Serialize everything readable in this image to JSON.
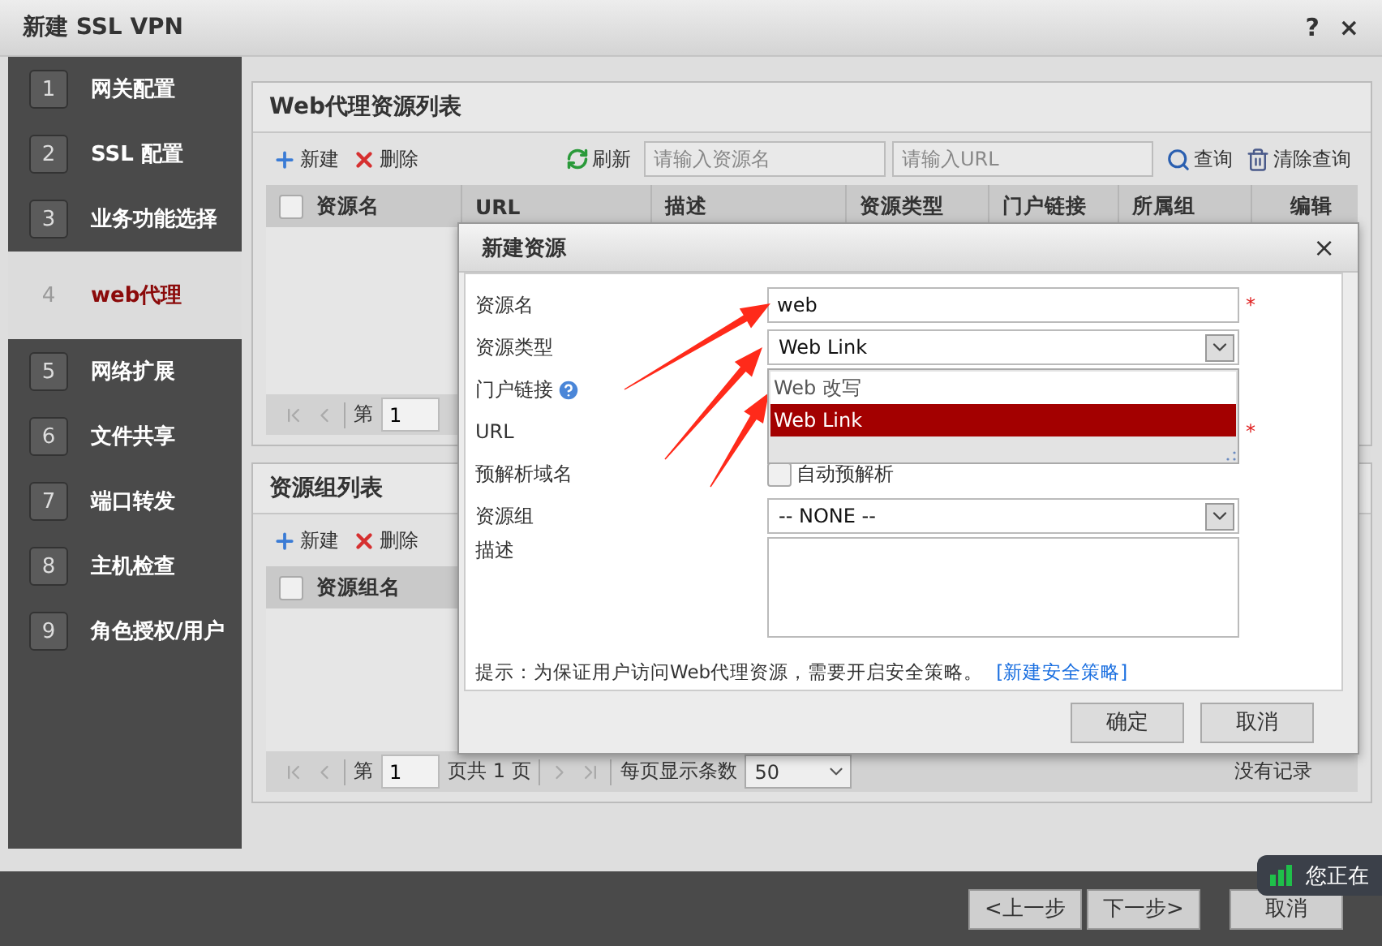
{
  "window": {
    "title": "新建 SSL VPN",
    "help": "?",
    "close": "×"
  },
  "steps": [
    {
      "number": "1",
      "label": "网关配置",
      "selected": false
    },
    {
      "number": "2",
      "label": "SSL 配置",
      "selected": false
    },
    {
      "number": "3",
      "label": "业务功能选择",
      "selected": false
    },
    {
      "number": "4",
      "label": "web代理",
      "selected": true
    },
    {
      "number": "5",
      "label": "网络扩展",
      "selected": false
    },
    {
      "number": "6",
      "label": "文件共享",
      "selected": false
    },
    {
      "number": "7",
      "label": "端口转发",
      "selected": false
    },
    {
      "number": "8",
      "label": "主机检查",
      "selected": false
    },
    {
      "number": "9",
      "label": "角色授权/用户",
      "selected": false
    }
  ],
  "resource_panel": {
    "title": "Web代理资源列表",
    "toolbar": {
      "new": "新建",
      "delete": "删除",
      "refresh": "刷新",
      "name_search": {
        "placeholder": "请输入资源名"
      },
      "url_search": {
        "placeholder": "请输入URL"
      },
      "query": "查询",
      "clear_query": "清除查询"
    },
    "select_all": {
      "checked": false
    },
    "columns": [
      "资源名",
      "URL",
      "描述",
      "资源类型",
      "门户链接",
      "所属组",
      "编辑"
    ],
    "pager": {
      "page_label": "第",
      "page": "1"
    }
  },
  "group_panel": {
    "title": "资源组列表",
    "toolbar": {
      "new": "新建",
      "delete": "删除"
    },
    "select_all": {
      "checked": false
    },
    "columns": [
      "资源组名"
    ],
    "pager": {
      "page_label": "第",
      "page": "1",
      "page_total": "页共 1 页",
      "per_page_label": "每页显示条数",
      "per_page": "50",
      "empty": "没有记录"
    }
  },
  "dialog": {
    "title": "新建资源",
    "close": "×",
    "fields": [
      {
        "kind": "text",
        "label": "资源名",
        "value": "web",
        "required_mark": "*"
      },
      {
        "kind": "select",
        "label": "资源类型",
        "value": "Web Link",
        "open": true,
        "options": [
          {
            "label": "Web 改写",
            "selected": false
          },
          {
            "label": "Web Link",
            "selected": true
          }
        ]
      },
      {
        "kind": "covered",
        "label": "门户链接",
        "help": true
      },
      {
        "kind": "text",
        "label": "URL",
        "required_mark": "*"
      },
      {
        "kind": "checkbox",
        "label": "预解析域名",
        "option": "自动预解析",
        "checked": false
      },
      {
        "kind": "select",
        "label": "资源组",
        "value": "-- NONE --"
      },
      {
        "kind": "textarea",
        "label": "描述"
      }
    ],
    "tip": "提示：为保证用户访问Web代理资源，需要开启安全策略。",
    "link": "[新建安全策略]",
    "buttons": [
      "确定",
      "取消"
    ]
  },
  "footer_buttons": [
    "<上一步",
    "下一步>",
    "取消"
  ],
  "toast": {
    "text": "您正在"
  }
}
